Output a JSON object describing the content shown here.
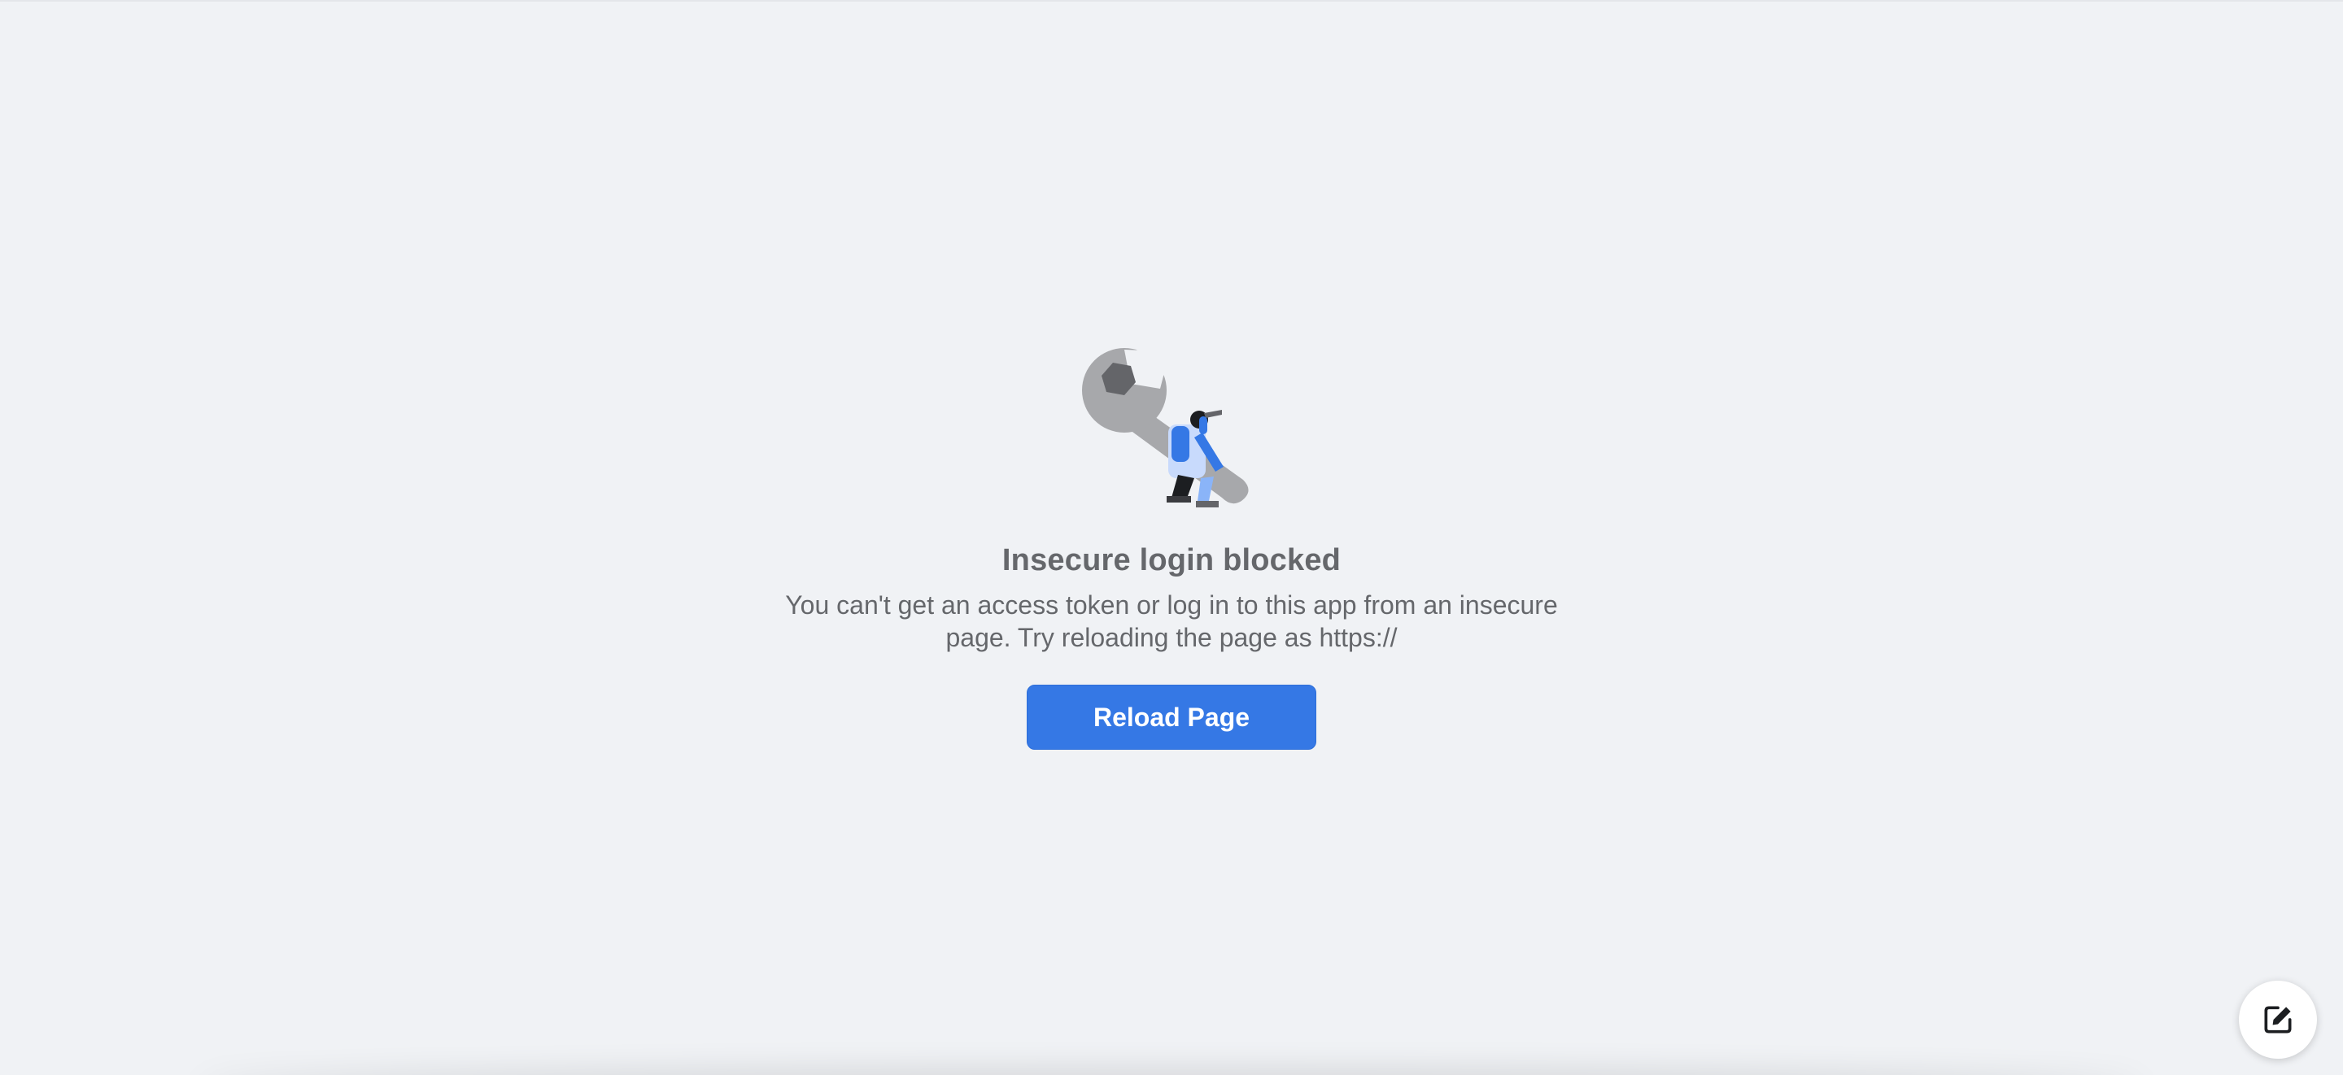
{
  "error": {
    "title": "Insecure login blocked",
    "message": "You can't get an access token or log in to this app from an insecure page. Try reloading the page as https://",
    "illustration_icon": "wrench-worker-illustration"
  },
  "actions": {
    "reload_label": "Reload Page"
  },
  "fab": {
    "icon": "compose-icon"
  },
  "colors": {
    "background": "#f0f2f5",
    "text": "#65676b",
    "button": "#3578e5",
    "button_text": "#ffffff"
  }
}
